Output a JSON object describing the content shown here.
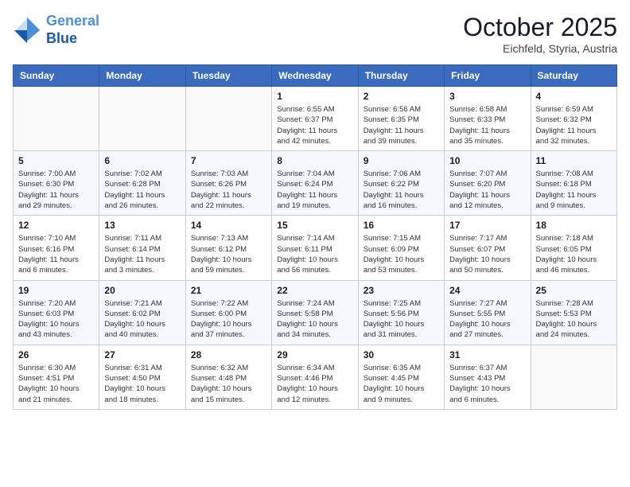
{
  "header": {
    "logo_line1": "General",
    "logo_line2": "Blue",
    "month": "October 2025",
    "location": "Eichfeld, Styria, Austria"
  },
  "days_of_week": [
    "Sunday",
    "Monday",
    "Tuesday",
    "Wednesday",
    "Thursday",
    "Friday",
    "Saturday"
  ],
  "weeks": [
    [
      {
        "day": "",
        "info": ""
      },
      {
        "day": "",
        "info": ""
      },
      {
        "day": "",
        "info": ""
      },
      {
        "day": "1",
        "info": "Sunrise: 6:55 AM\nSunset: 6:37 PM\nDaylight: 11 hours\nand 42 minutes."
      },
      {
        "day": "2",
        "info": "Sunrise: 6:56 AM\nSunset: 6:35 PM\nDaylight: 11 hours\nand 39 minutes."
      },
      {
        "day": "3",
        "info": "Sunrise: 6:58 AM\nSunset: 6:33 PM\nDaylight: 11 hours\nand 35 minutes."
      },
      {
        "day": "4",
        "info": "Sunrise: 6:59 AM\nSunset: 6:32 PM\nDaylight: 11 hours\nand 32 minutes."
      }
    ],
    [
      {
        "day": "5",
        "info": "Sunrise: 7:00 AM\nSunset: 6:30 PM\nDaylight: 11 hours\nand 29 minutes."
      },
      {
        "day": "6",
        "info": "Sunrise: 7:02 AM\nSunset: 6:28 PM\nDaylight: 11 hours\nand 26 minutes."
      },
      {
        "day": "7",
        "info": "Sunrise: 7:03 AM\nSunset: 6:26 PM\nDaylight: 11 hours\nand 22 minutes."
      },
      {
        "day": "8",
        "info": "Sunrise: 7:04 AM\nSunset: 6:24 PM\nDaylight: 11 hours\nand 19 minutes."
      },
      {
        "day": "9",
        "info": "Sunrise: 7:06 AM\nSunset: 6:22 PM\nDaylight: 11 hours\nand 16 minutes."
      },
      {
        "day": "10",
        "info": "Sunrise: 7:07 AM\nSunset: 6:20 PM\nDaylight: 11 hours\nand 12 minutes."
      },
      {
        "day": "11",
        "info": "Sunrise: 7:08 AM\nSunset: 6:18 PM\nDaylight: 11 hours\nand 9 minutes."
      }
    ],
    [
      {
        "day": "12",
        "info": "Sunrise: 7:10 AM\nSunset: 6:16 PM\nDaylight: 11 hours\nand 6 minutes."
      },
      {
        "day": "13",
        "info": "Sunrise: 7:11 AM\nSunset: 6:14 PM\nDaylight: 11 hours\nand 3 minutes."
      },
      {
        "day": "14",
        "info": "Sunrise: 7:13 AM\nSunset: 6:12 PM\nDaylight: 10 hours\nand 59 minutes."
      },
      {
        "day": "15",
        "info": "Sunrise: 7:14 AM\nSunset: 6:11 PM\nDaylight: 10 hours\nand 56 minutes."
      },
      {
        "day": "16",
        "info": "Sunrise: 7:15 AM\nSunset: 6:09 PM\nDaylight: 10 hours\nand 53 minutes."
      },
      {
        "day": "17",
        "info": "Sunrise: 7:17 AM\nSunset: 6:07 PM\nDaylight: 10 hours\nand 50 minutes."
      },
      {
        "day": "18",
        "info": "Sunrise: 7:18 AM\nSunset: 6:05 PM\nDaylight: 10 hours\nand 46 minutes."
      }
    ],
    [
      {
        "day": "19",
        "info": "Sunrise: 7:20 AM\nSunset: 6:03 PM\nDaylight: 10 hours\nand 43 minutes."
      },
      {
        "day": "20",
        "info": "Sunrise: 7:21 AM\nSunset: 6:02 PM\nDaylight: 10 hours\nand 40 minutes."
      },
      {
        "day": "21",
        "info": "Sunrise: 7:22 AM\nSunset: 6:00 PM\nDaylight: 10 hours\nand 37 minutes."
      },
      {
        "day": "22",
        "info": "Sunrise: 7:24 AM\nSunset: 5:58 PM\nDaylight: 10 hours\nand 34 minutes."
      },
      {
        "day": "23",
        "info": "Sunrise: 7:25 AM\nSunset: 5:56 PM\nDaylight: 10 hours\nand 31 minutes."
      },
      {
        "day": "24",
        "info": "Sunrise: 7:27 AM\nSunset: 5:55 PM\nDaylight: 10 hours\nand 27 minutes."
      },
      {
        "day": "25",
        "info": "Sunrise: 7:28 AM\nSunset: 5:53 PM\nDaylight: 10 hours\nand 24 minutes."
      }
    ],
    [
      {
        "day": "26",
        "info": "Sunrise: 6:30 AM\nSunset: 4:51 PM\nDaylight: 10 hours\nand 21 minutes."
      },
      {
        "day": "27",
        "info": "Sunrise: 6:31 AM\nSunset: 4:50 PM\nDaylight: 10 hours\nand 18 minutes."
      },
      {
        "day": "28",
        "info": "Sunrise: 6:32 AM\nSunset: 4:48 PM\nDaylight: 10 hours\nand 15 minutes."
      },
      {
        "day": "29",
        "info": "Sunrise: 6:34 AM\nSunset: 4:46 PM\nDaylight: 10 hours\nand 12 minutes."
      },
      {
        "day": "30",
        "info": "Sunrise: 6:35 AM\nSunset: 4:45 PM\nDaylight: 10 hours\nand 9 minutes."
      },
      {
        "day": "31",
        "info": "Sunrise: 6:37 AM\nSunset: 4:43 PM\nDaylight: 10 hours\nand 6 minutes."
      },
      {
        "day": "",
        "info": ""
      }
    ]
  ]
}
